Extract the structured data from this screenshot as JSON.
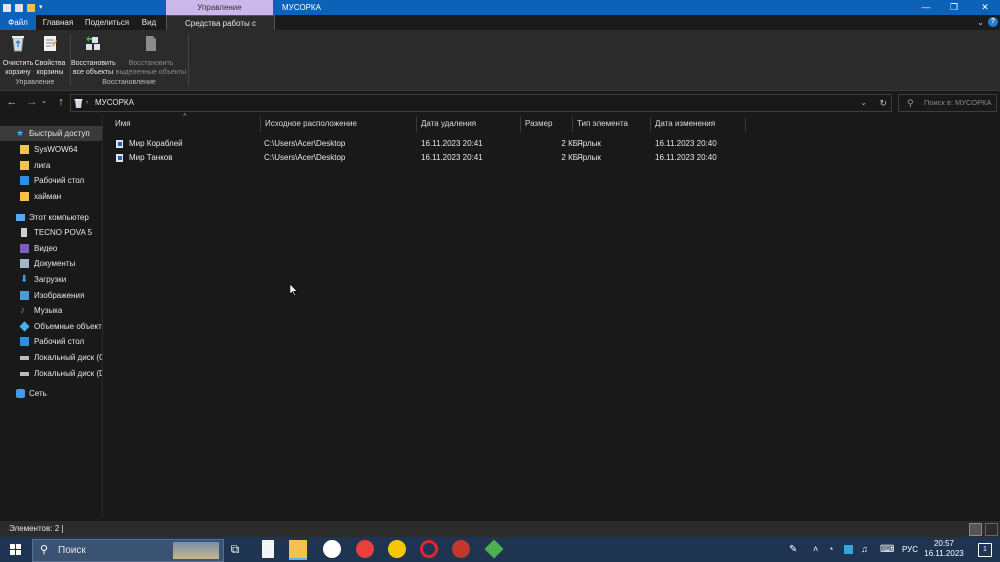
{
  "titlebar": {
    "manage_tab": "Управление",
    "window_title": "МУСОРКА",
    "minimize": "—",
    "maximize": "❐",
    "close": "✕"
  },
  "tabs": {
    "file": "Файл",
    "home": "Главная",
    "share": "Поделиться",
    "view": "Вид",
    "recycle_tools": "Средства работы с корзиной",
    "help": "?"
  },
  "ribbon": {
    "empty_bin": "Очистить корзину",
    "bin_props": "Свойства корзины",
    "group_manage": "Управление",
    "restore_all": "Восстановить все объекты",
    "restore_selected": "Восстановить выделенные объекты",
    "group_restore": "Восстановление"
  },
  "address": {
    "path": "МУСОРКА",
    "search_placeholder": "Поиск в: МУСОРКА"
  },
  "sidebar": {
    "items": [
      {
        "label": "Быстрый доступ",
        "icon": "star-icon"
      },
      {
        "label": "SysWOW64",
        "icon": "folder-icon"
      },
      {
        "label": "лига",
        "icon": "folder-icon"
      },
      {
        "label": "Рабочий стол",
        "icon": "desktop-folder-icon"
      },
      {
        "label": "хайман",
        "icon": "folder-icon"
      },
      {
        "label": "Этот компьютер",
        "icon": "computer-icon"
      },
      {
        "label": "TECNO POVA 5",
        "icon": "phone-icon"
      },
      {
        "label": "Видео",
        "icon": "video-folder-icon"
      },
      {
        "label": "Документы",
        "icon": "documents-folder-icon"
      },
      {
        "label": "Загрузки",
        "icon": "downloads-folder-icon"
      },
      {
        "label": "Изображения",
        "icon": "pictures-folder-icon"
      },
      {
        "label": "Музыка",
        "icon": "music-folder-icon"
      },
      {
        "label": "Объемные объекты",
        "icon": "3d-objects-folder-icon"
      },
      {
        "label": "Рабочий стол",
        "icon": "desktop-folder-icon"
      },
      {
        "label": "Локальный диск (C:)",
        "icon": "drive-icon"
      },
      {
        "label": "Локальный диск (D:)",
        "icon": "drive-icon"
      },
      {
        "label": "Сеть",
        "icon": "network-icon"
      }
    ]
  },
  "columns": {
    "name": "Имя",
    "original_location": "Исходное расположение",
    "date_deleted": "Дата удаления",
    "size": "Размер",
    "item_type": "Тип элемента",
    "date_modified": "Дата изменения"
  },
  "files": [
    {
      "name": "Мир Кораблей",
      "location": "C:\\Users\\Acer\\Desktop",
      "deleted": "16.11.2023 20:41",
      "size": "2 КБ",
      "type": "Ярлык",
      "modified": "16.11.2023 20:40"
    },
    {
      "name": "Мир Танков",
      "location": "C:\\Users\\Acer\\Desktop",
      "deleted": "16.11.2023 20:41",
      "size": "2 КБ",
      "type": "Ярлык",
      "modified": "16.11.2023 20:40"
    }
  ],
  "status": {
    "items_count": "Элементов: 2"
  },
  "taskbar": {
    "search_label": "Поиск",
    "lang": "РУС",
    "time": "20:57",
    "date": "16.11.2023",
    "notif_count": "1"
  },
  "colors": {
    "accent": "#0b62b8",
    "manage_tab": "#cbb7e9",
    "background": "#191919",
    "taskbar": "#1e3450"
  }
}
